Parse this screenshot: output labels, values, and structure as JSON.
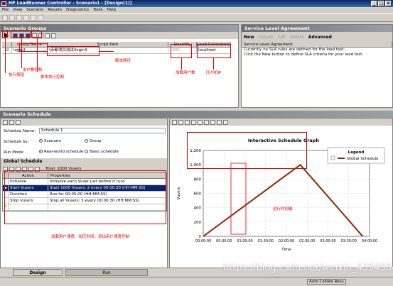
{
  "window": {
    "title": "HP LoadRunner Controller - Scenario1 - [Design(1)]"
  },
  "menu": [
    "File",
    "View",
    "Scenario",
    "Results",
    "Diagnostics",
    "Tools",
    "Help"
  ],
  "scenario_groups": {
    "header": "Scenario Groups",
    "columns": [
      "Group Name",
      "Script Path",
      "Quantity",
      "Load Generators"
    ],
    "rows": [
      {
        "group_name": "login3",
        "script_path": "\\赤都项目测试\\login3",
        "quantity": "1000",
        "load_generator": "localhost"
      }
    ]
  },
  "sla": {
    "header": "Service Level Agreement",
    "buttons": [
      "New",
      "Details",
      "Edit",
      "Delete",
      "Advanced"
    ],
    "grid_header": "Service Level Agreement",
    "text1": "Currently no SLA rules are defined for the load test.",
    "text2": "Click the New button to define SLA criteria for your load test."
  },
  "annotations": {
    "exec_button": "执行按钮",
    "user_count_control": "用户数控制",
    "script_exec_control": "脚本执行控制",
    "script_path": "脚本路径",
    "add_users": "加载用户数",
    "load_gen_ip": "压力机IP",
    "run_time_axis": "运行时间轴",
    "ramp_control": "加载用户速度、加压时间、退出用户速度控制"
  },
  "schedule": {
    "header": "Scenario Schedule",
    "schedule_name_label": "Schedule Name:",
    "schedule_name_value": "Schedule 1",
    "schedule_by_label": "Schedule by:",
    "schedule_by_options": [
      "Scenario",
      "Group"
    ],
    "run_mode_label": "Run Mode:",
    "run_mode_options": [
      "Real-world schedule",
      "Basic schedule"
    ],
    "global_header": "Global Schedule",
    "total_label": "Total: 1000 Vusers",
    "columns": [
      "Action",
      "Properties"
    ],
    "rows": [
      {
        "action": "Initialize",
        "properties": "Initialize each Vuser just before it runs"
      },
      {
        "action": "Start Vusers",
        "properties": "Start 1000 Vusers: 2 every 00:00:30 (HH:MM:SS)"
      },
      {
        "action": "Duration",
        "properties": "Run for 00:05:00 (HH:MM:SS)"
      },
      {
        "action": "Stop Vusers",
        "properties": "Stop all Vusers: 5 every 00:00:30 (HH:MM:SS)"
      }
    ]
  },
  "graph_panel": {
    "zoom_text": ""
  },
  "tabs": [
    "Design",
    "Run"
  ],
  "status": {
    "auto_collate": "Auto Collate Resu",
    "watermark": "https://blog.csdn.net/weixin_43949842"
  },
  "chart_data": {
    "type": "line",
    "title": "Interactive Schedule Graph",
    "xlabel": "Time",
    "ylabel": "Vusers",
    "x": [
      "00:00:00",
      "00:30:00",
      "01:00:00",
      "01:30:00",
      "02:00:00",
      "02:30:00",
      "03:00:00",
      "03:30:00",
      "04:00:00"
    ],
    "yticks": [
      0,
      200,
      400,
      600,
      800,
      "1,000",
      "1,200"
    ],
    "ylim": [
      0,
      1200
    ],
    "series": [
      {
        "name": "Global Schedule",
        "points": [
          [
            "00:00:00",
            0
          ],
          [
            "02:20:00",
            1000
          ],
          [
            "03:50:00",
            0
          ]
        ]
      }
    ],
    "legend": {
      "title": "Legend",
      "position": "top-right"
    },
    "grid": true
  }
}
